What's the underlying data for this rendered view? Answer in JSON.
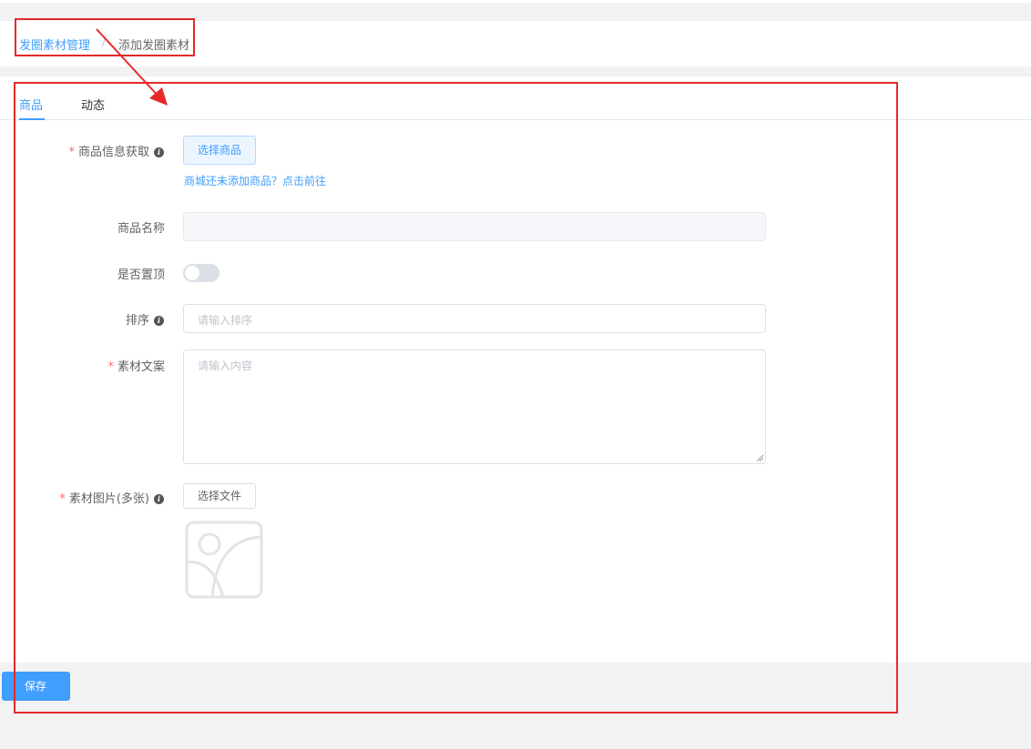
{
  "breadcrumb": {
    "parent": "发圈素材管理",
    "separator": "/",
    "current": "添加发圈素材"
  },
  "tabs": [
    {
      "label": "商品",
      "active": true
    },
    {
      "label": "动态",
      "active": false
    }
  ],
  "form": {
    "product_info": {
      "required_mark": "*",
      "label": "商品信息获取",
      "button": "选择商品",
      "hint_link": "商城还未添加商品？点击前往"
    },
    "product_name": {
      "label": "商品名称",
      "value": ""
    },
    "pin_top": {
      "label": "是否置顶",
      "on": false
    },
    "sort": {
      "label": "排序",
      "placeholder": "请输入排序"
    },
    "copy_text": {
      "required_mark": "*",
      "label": "素材文案",
      "placeholder": "请输入内容"
    },
    "images": {
      "required_mark": "*",
      "label": "素材图片(多张)",
      "button": "选择文件"
    }
  },
  "actions": {
    "save": "保存"
  },
  "colors": {
    "accent": "#409eff",
    "annotation": "#e52a2a",
    "required": "#f56c6c"
  }
}
